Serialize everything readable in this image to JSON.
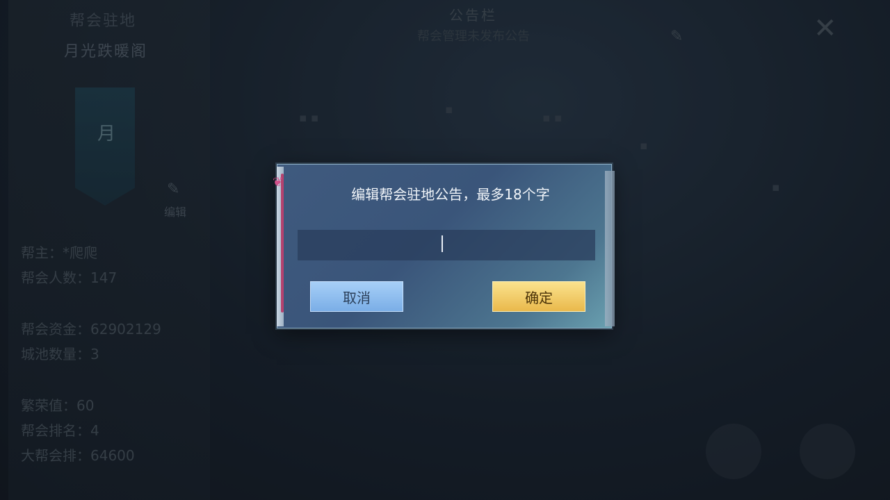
{
  "background": {
    "guild_station_label": "帮会驻地",
    "guild_name": "月光跌暖阁",
    "banner_char": "月",
    "edit_label": "编辑",
    "stats": [
      "帮主：*爬爬",
      "帮会人数：147",
      "帮会资金：62902129",
      "城池数量：3",
      "繁荣值：60",
      "帮会排名：4",
      "大帮会排：64600"
    ],
    "notice_title": "公告栏",
    "notice_sub": "帮会管理未发布公告"
  },
  "dialog": {
    "title": "编辑帮会驻地公告，最多18个字",
    "input_value": "",
    "cancel_label": "取消",
    "confirm_label": "确定"
  },
  "colors": {
    "cancel_button": "#8bbcef",
    "confirm_button": "#f2cf6a",
    "dialog_bg": "#3f5a7e"
  },
  "icons": [
    "close-icon",
    "pencil-icon",
    "ribbon-bookmark-icon"
  ]
}
